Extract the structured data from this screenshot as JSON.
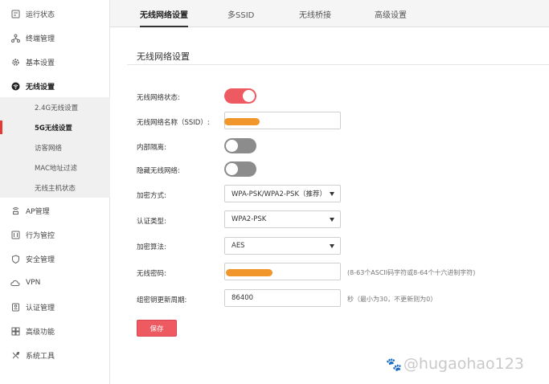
{
  "sidebar": {
    "items": [
      {
        "label": "运行状态",
        "icon": "monitor-icon"
      },
      {
        "label": "终端管理",
        "icon": "network-icon"
      },
      {
        "label": "基本设置",
        "icon": "gear-icon"
      },
      {
        "label": "无线设置",
        "icon": "wifi-icon"
      },
      {
        "label": "AP管理",
        "icon": "access-point-icon"
      },
      {
        "label": "行为管控",
        "icon": "control-icon"
      },
      {
        "label": "安全管理",
        "icon": "shield-icon"
      },
      {
        "label": "VPN",
        "icon": "cloud-icon"
      },
      {
        "label": "认证管理",
        "icon": "id-card-icon"
      },
      {
        "label": "高级功能",
        "icon": "grid-icon"
      },
      {
        "label": "系统工具",
        "icon": "tools-icon"
      }
    ],
    "submenu": [
      {
        "label": "2.4G无线设置"
      },
      {
        "label": "5G无线设置"
      },
      {
        "label": "访客网络"
      },
      {
        "label": "MAC地址过滤"
      },
      {
        "label": "无线主机状态"
      }
    ]
  },
  "tabs": [
    {
      "label": "无线网络设置"
    },
    {
      "label": "多SSID"
    },
    {
      "label": "无线桥接"
    },
    {
      "label": "高级设置"
    }
  ],
  "form": {
    "section_title": "无线网络设置",
    "wireless_status_label": "无线网络状态:",
    "wireless_status": true,
    "ssid_label": "无线网络名称（SSID）:",
    "isolation_label": "内部隔离:",
    "isolation": false,
    "hide_ssid_label": "隐藏无线网络:",
    "hide_ssid": false,
    "encryption_label": "加密方式:",
    "encryption_value": "WPA-PSK/WPA2-PSK（推荐）",
    "auth_label": "认证类型:",
    "auth_value": "WPA2-PSK",
    "algorithm_label": "加密算法:",
    "algorithm_value": "AES",
    "password_label": "无线密码:",
    "password_hint": "(8-63个ASCII码字符或8-64个十六进制字符)",
    "rekey_label": "组密钥更新周期:",
    "rekey_value": "86400",
    "rekey_hint": "秒（最小为30，不更新则为0）",
    "save_label": "保存"
  },
  "watermark": {
    "text": "@hugaohao123"
  },
  "colors": {
    "accent": "#ee5a62",
    "redaction": "#f0962a",
    "toggle_off": "#8c8c8c"
  }
}
